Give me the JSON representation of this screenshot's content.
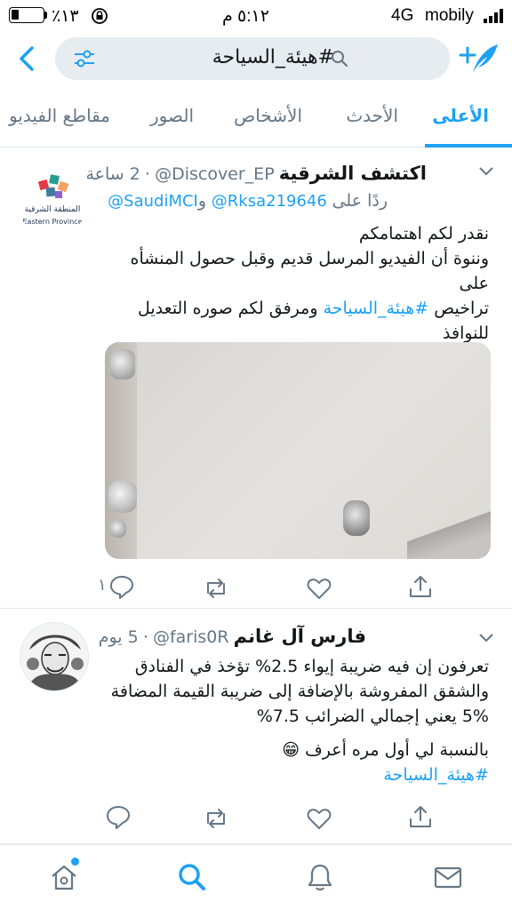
{
  "status_bar": {
    "carrier": "mobily",
    "network": "4G",
    "time": "٥:١٢ م",
    "battery_pct": "٪١٣",
    "battery_level": 0.13
  },
  "search": {
    "query": "#هيئة_السياحة"
  },
  "tabs": [
    {
      "label": "الأعلى",
      "active": true
    },
    {
      "label": "الأحدث",
      "active": false
    },
    {
      "label": "الأشخاص",
      "active": false
    },
    {
      "label": "الصور",
      "active": false
    },
    {
      "label": "مقاطع الفيديو",
      "active": false
    }
  ],
  "tweets": [
    {
      "display_name": "اكتشف الشرقية",
      "handle": "@Discover_EP",
      "time": "2 ساعة",
      "reply_prefix": "ردًا على",
      "reply_to_1": "@Rksa219646",
      "reply_and": "و",
      "reply_to_2": "@SaudiMCI",
      "text_line1": "نقدر لكم اهتمامكم",
      "text_line2": "وننوة أن الفيديو المرسل قديم وقبل حصول المنشأه على",
      "text_line3_a": "تراخيص",
      "hashtag": "#هيئة_السياحة",
      "text_line3_b": "ومرفق لكم صوره التعديل",
      "text_line4": "للنوافذ",
      "avatar_text": "المنطقة الشرقية",
      "avatar_text_en": "Eastern Province",
      "reply_count": "١"
    },
    {
      "display_name": "فارس آل غانم",
      "handle": "@faris0R",
      "time": "5 يوم",
      "text_line1": "تعرفون إن فيه ضريبة إيواء 2.5% تؤخذ في الفنادق",
      "text_line2": "والشقق المفروشة بالإضافة إلى ضريبة القيمة المضافة",
      "text_line3": "5% يعني إجمالي الضرائب 7.5%",
      "text_line4": "بالنسبة لي أول مره أعرف",
      "emoji": "😁",
      "hashtag": "#هيئة_السياحة"
    }
  ],
  "colors": {
    "accent": "#1da1f2",
    "secondary_text": "#657786",
    "divider": "#e1e8ed"
  }
}
